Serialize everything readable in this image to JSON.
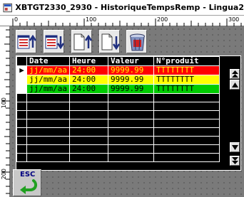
{
  "window": {
    "title": "XBTGT2330_2930 - HistoriqueTempsRemp - Lingua2"
  },
  "rulers": {
    "top_marks": [
      "0",
      "100",
      "200",
      "300"
    ],
    "left_marks": [
      "100",
      "200"
    ]
  },
  "toolbar": {
    "buttons": [
      {
        "name": "list-up-button",
        "icon": "list-up-arrow-icon"
      },
      {
        "name": "list-down-button",
        "icon": "list-down-arrow-icon"
      },
      {
        "name": "page-up-button",
        "icon": "page-up-arrow-icon"
      },
      {
        "name": "page-down-button",
        "icon": "page-down-arrow-icon"
      },
      {
        "name": "delete-button",
        "icon": "trash-bin-icon"
      }
    ]
  },
  "table": {
    "headers": [
      "Date",
      "Heure",
      "Valeur",
      "N°produit"
    ],
    "rows": [
      {
        "date": "jj/mm/aa",
        "heure": "24:00",
        "valeur": "9999.99",
        "produit": "TTTTTTTT",
        "color": "#ff0000",
        "selected": true
      },
      {
        "date": "jj/mm/aa",
        "heure": "24:00",
        "valeur": "9999.99",
        "produit": "TTTTTTTT",
        "color": "#ffff00",
        "selected": false
      },
      {
        "date": "jj/mm/aa",
        "heure": "24:00",
        "valeur": "9999.99",
        "produit": "TTTTTTTT",
        "color": "#00cc00",
        "selected": false
      }
    ],
    "empty_rows": 8
  },
  "esc_button": {
    "label": "ESC"
  },
  "colors": {
    "canvas": "#7a7a7a",
    "table_bg": "#000000",
    "header_text": "#ffffff"
  }
}
